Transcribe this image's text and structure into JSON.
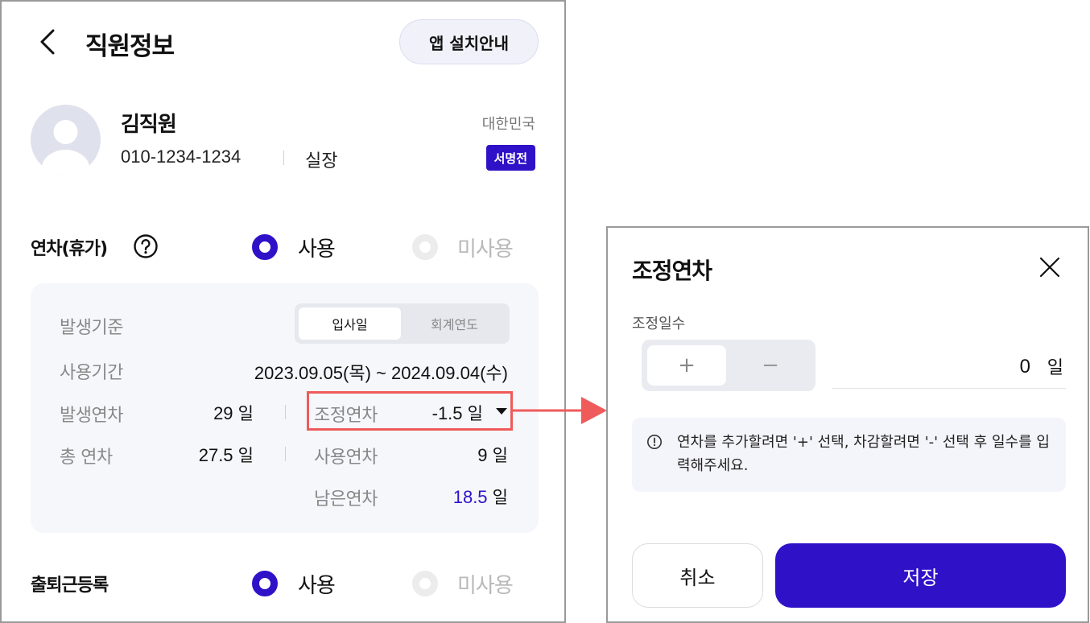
{
  "header": {
    "title": "직원정보",
    "install_guide": "앱 설치안내"
  },
  "employee": {
    "name": "김직원",
    "phone": "010-1234-1234",
    "role": "실장",
    "country": "대한민국",
    "badge": "서명전"
  },
  "leave": {
    "label": "연차(휴가)",
    "options": {
      "use": "사용",
      "unused": "미사용",
      "selected": "사용"
    },
    "basis_label": "발생기준",
    "basis_options": [
      "입사일",
      "회계연도"
    ],
    "basis_selected": "입사일",
    "period_label": "사용기간",
    "period_value": "2023.09.05(목) ~ 2024.09.04(수)",
    "accrued_label": "발생연차",
    "accrued_value": "29",
    "adjusted_label": "조정연차",
    "adjusted_value": "-1.5",
    "total_label": "총 연차",
    "total_value": "27.5",
    "used_label": "사용연차",
    "used_value": "9",
    "remaining_label": "남은연차",
    "remaining_value": "18.5",
    "unit": "일"
  },
  "attendance": {
    "label": "출퇴근등록",
    "options": {
      "use": "사용",
      "unused": "미사용",
      "selected": "사용"
    }
  },
  "modal": {
    "title": "조정연차",
    "field_label": "조정일수",
    "plus": "+",
    "minus": "−",
    "value": "0",
    "unit": "일",
    "info": "연차를 추가할려면 '+' 선택, 차감할려면 '-' 선택 후 일수를 입력해주세요.",
    "cancel": "취소",
    "save": "저장"
  },
  "colors": {
    "accent": "#2f12c8",
    "highlight": "#ef5a5a",
    "muted": "#888888"
  }
}
